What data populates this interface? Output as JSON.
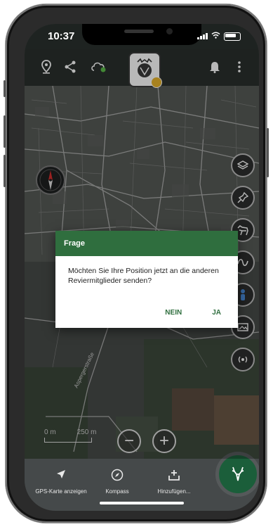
{
  "status_bar": {
    "time": "10:37"
  },
  "toolbar": {
    "icons": [
      "location-pin-icon",
      "share-icon",
      "cloud-sync-icon",
      "bell-icon",
      "more-vert-icon"
    ],
    "logo": "hunting-club-logo"
  },
  "map": {
    "right_buttons": [
      "layers-icon",
      "pin-icon",
      "dog-icon",
      "track-icon",
      "person-icon",
      "photo-icon",
      "broadcast-icon"
    ],
    "street_label": "Aspergerstraße",
    "scale_labels": [
      "0 m",
      "250 m"
    ],
    "zoom_out_symbol": "−",
    "zoom_in_symbol": "+"
  },
  "bottom_bar": {
    "items": [
      {
        "label": "GPS-Karte anzeigen",
        "icon": "navigation-arrow-icon"
      },
      {
        "label": "Kompass",
        "icon": "compass-icon"
      },
      {
        "label": "Hinzufügen...",
        "icon": "add-tray-icon"
      }
    ]
  },
  "dialog": {
    "title": "Frage",
    "message": "Möchten Sie Ihre Position jetzt an die anderen Reviermitglieder senden?",
    "negative_label": "NEIN",
    "positive_label": "JA"
  },
  "colors": {
    "accent_green": "#2f6e3e",
    "fab_green": "#1b5e3a"
  }
}
